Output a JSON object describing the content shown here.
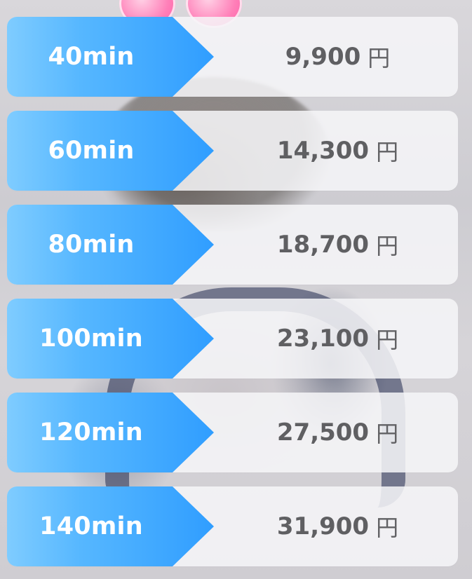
{
  "pricing": {
    "rows": [
      {
        "duration": "40min",
        "price": "9,900",
        "currency": "円"
      },
      {
        "duration": "60min",
        "price": "14,300",
        "currency": "円"
      },
      {
        "duration": "80min",
        "price": "18,700",
        "currency": "円"
      },
      {
        "duration": "100min",
        "price": "23,100",
        "currency": "円"
      },
      {
        "duration": "120min",
        "price": "27,500",
        "currency": "円"
      },
      {
        "duration": "140min",
        "price": "31,900",
        "currency": "円"
      }
    ]
  },
  "colors": {
    "duration_gradient_start": "#7fccff",
    "duration_gradient_end": "#2f9dff",
    "price_text": "#5f5f62",
    "row_background": "#f6f6f8"
  }
}
